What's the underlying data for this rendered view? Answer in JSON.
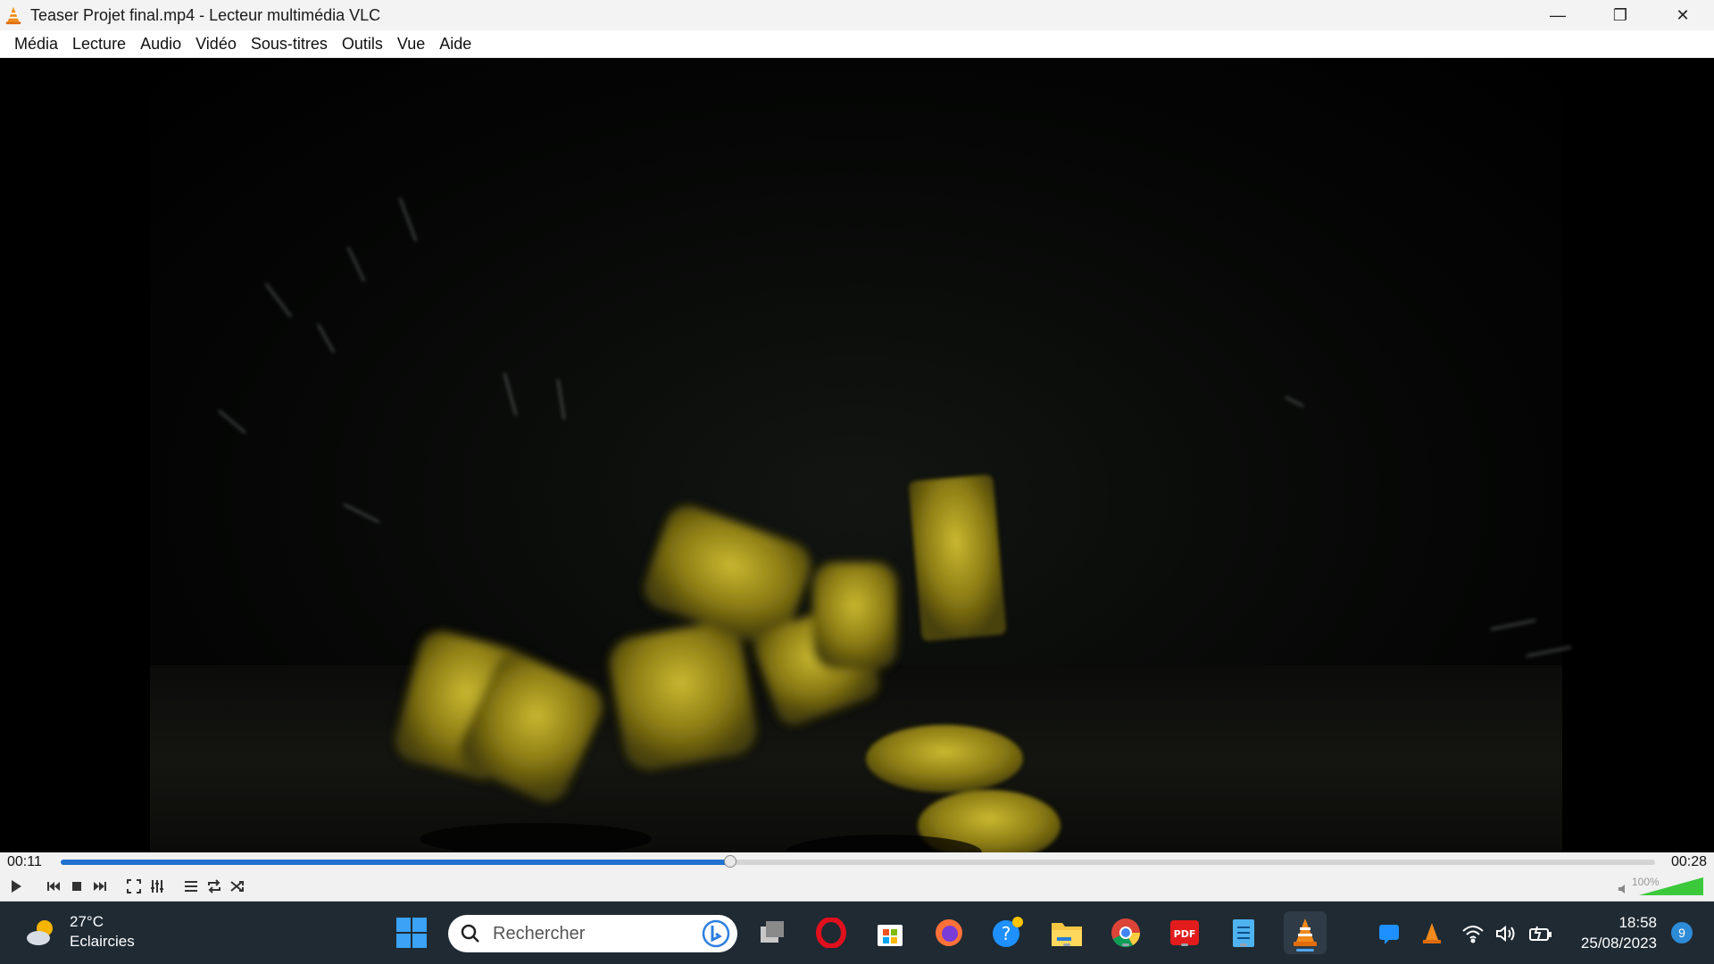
{
  "window": {
    "title": "Teaser Projet final.mp4 - Lecteur multimédia VLC",
    "minimize_glyph": "—",
    "restore_glyph": "❐",
    "close_glyph": "✕"
  },
  "menu": {
    "items": [
      "Média",
      "Lecture",
      "Audio",
      "Vidéo",
      "Sous-titres",
      "Outils",
      "Vue",
      "Aide"
    ]
  },
  "player": {
    "elapsed": "00:11",
    "duration": "00:28",
    "progress_fraction": 0.42,
    "volume_label": "100%",
    "volume_fraction": 1.0,
    "accent_color": "#1f72d0"
  },
  "taskbar": {
    "weather_temp": "27°C",
    "weather_desc": "Eclaircies",
    "search_placeholder": "Rechercher",
    "time": "18:58",
    "date": "25/08/2023",
    "notification_count": "9",
    "icons": [
      "windows-start-icon",
      "search-icon",
      "bing-icon",
      "task-view-icon",
      "opera-icon",
      "microsoft-store-icon",
      "firefox-icon",
      "get-help-icon",
      "file-explorer-icon",
      "chrome-icon",
      "pdf-icon",
      "notepad-icon",
      "vlc-icon"
    ],
    "tray_icons": [
      "messaging-icon",
      "vlc-tray-icon",
      "wifi-icon",
      "volume-icon",
      "battery-icon"
    ]
  }
}
